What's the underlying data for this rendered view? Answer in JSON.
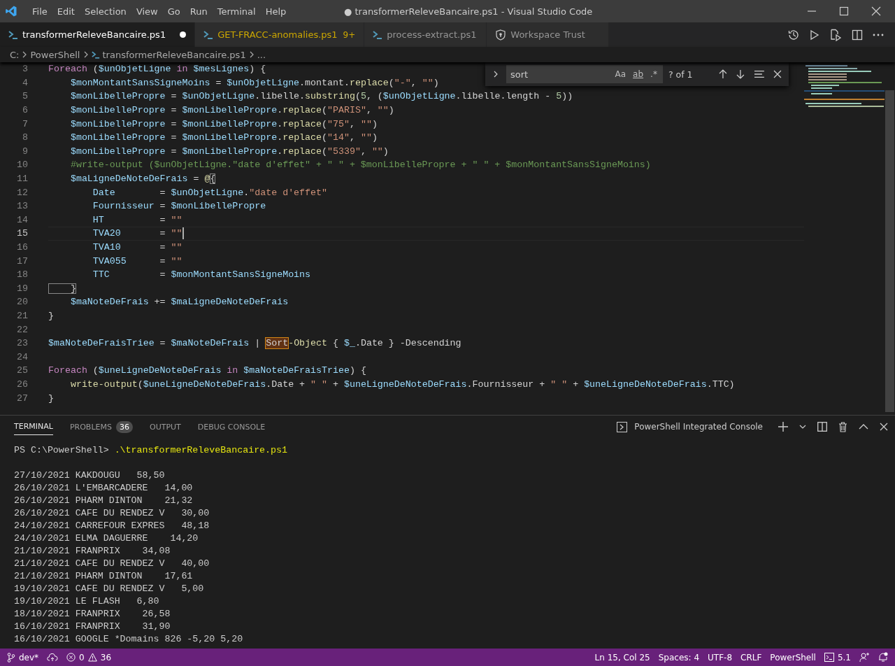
{
  "title_bar": {
    "menu": [
      "File",
      "Edit",
      "Selection",
      "View",
      "Go",
      "Run",
      "Terminal",
      "Help"
    ],
    "title": "● transformerReleveBancaire.ps1 - Visual Studio Code"
  },
  "tabs": [
    {
      "label": "transformerReleveBancaire.ps1",
      "selected": true,
      "kind": "file",
      "modified": true,
      "warning": false
    },
    {
      "label": "GET-FRACC-anomalies.ps1",
      "selected": false,
      "kind": "file",
      "modified": false,
      "warning": true,
      "badge": "9+"
    },
    {
      "label": "process-extract.ps1",
      "selected": false,
      "kind": "file",
      "modified": false,
      "warning": false
    },
    {
      "label": "Workspace Trust",
      "selected": false,
      "kind": "trust",
      "modified": false,
      "warning": false
    }
  ],
  "breadcrumb": [
    "C:",
    "PowerShell",
    "transformerReleveBancaire.ps1",
    "..."
  ],
  "find": {
    "value": "sort",
    "options": [
      {
        "label": "Aa",
        "on": false
      },
      {
        "label": "ab",
        "on": false
      },
      {
        "label": ".*",
        "on": false
      }
    ],
    "result": "? of 1"
  },
  "editor": {
    "lines": [
      {
        "number": "3",
        "current": false,
        "tokens": [
          {
            "kind": "k",
            "t": "Foreach"
          },
          {
            "kind": "p",
            "t": " ("
          },
          {
            "kind": "v",
            "t": "$unObjetLigne"
          },
          {
            "kind": "k",
            "t": " in "
          },
          {
            "kind": "v",
            "t": "$mesLignes"
          },
          {
            "kind": "p",
            "t": ") {"
          }
        ]
      },
      {
        "number": "4",
        "current": false,
        "tokens": [
          {
            "kind": "v",
            "t": "    $monMontantSansSigneMoins"
          },
          {
            "kind": "p",
            "t": " = "
          },
          {
            "kind": "v",
            "t": "$unObjetLigne"
          },
          {
            "kind": "p",
            "t": ".montant."
          },
          {
            "kind": "f",
            "t": "replace"
          },
          {
            "kind": "p",
            "t": "("
          },
          {
            "kind": "s",
            "t": "\"-\""
          },
          {
            "kind": "p",
            "t": ", "
          },
          {
            "kind": "s",
            "t": "\"\""
          },
          {
            "kind": "p",
            "t": ")"
          }
        ]
      },
      {
        "number": "5",
        "current": false,
        "tokens": [
          {
            "kind": "v",
            "t": "    $monLibellePropre"
          },
          {
            "kind": "p",
            "t": " = "
          },
          {
            "kind": "v",
            "t": "$unObjetLigne"
          },
          {
            "kind": "p",
            "t": ".libelle."
          },
          {
            "kind": "f",
            "t": "substring"
          },
          {
            "kind": "p",
            "t": "("
          },
          {
            "kind": "n",
            "t": "5"
          },
          {
            "kind": "p",
            "t": ", ("
          },
          {
            "kind": "v",
            "t": "$unObjetLigne"
          },
          {
            "kind": "p",
            "t": ".libelle.length - "
          },
          {
            "kind": "n",
            "t": "5"
          },
          {
            "kind": "p",
            "t": "))"
          }
        ]
      },
      {
        "number": "6",
        "current": false,
        "tokens": [
          {
            "kind": "v",
            "t": "    $monLibellePropre"
          },
          {
            "kind": "p",
            "t": " = "
          },
          {
            "kind": "v",
            "t": "$monLibellePropre"
          },
          {
            "kind": "p",
            "t": "."
          },
          {
            "kind": "f",
            "t": "replace"
          },
          {
            "kind": "p",
            "t": "("
          },
          {
            "kind": "s",
            "t": "\"PARIS\""
          },
          {
            "kind": "p",
            "t": ", "
          },
          {
            "kind": "s",
            "t": "\"\""
          },
          {
            "kind": "p",
            "t": ")"
          }
        ]
      },
      {
        "number": "7",
        "current": false,
        "tokens": [
          {
            "kind": "v",
            "t": "    $monLibellePropre"
          },
          {
            "kind": "p",
            "t": " = "
          },
          {
            "kind": "v",
            "t": "$monLibellePropre"
          },
          {
            "kind": "p",
            "t": "."
          },
          {
            "kind": "f",
            "t": "replace"
          },
          {
            "kind": "p",
            "t": "("
          },
          {
            "kind": "s",
            "t": "\"75\""
          },
          {
            "kind": "p",
            "t": ", "
          },
          {
            "kind": "s",
            "t": "\"\""
          },
          {
            "kind": "p",
            "t": ")"
          }
        ]
      },
      {
        "number": "8",
        "current": false,
        "tokens": [
          {
            "kind": "v",
            "t": "    $monLibellePropre"
          },
          {
            "kind": "p",
            "t": " = "
          },
          {
            "kind": "v",
            "t": "$monLibellePropre"
          },
          {
            "kind": "p",
            "t": "."
          },
          {
            "kind": "f",
            "t": "replace"
          },
          {
            "kind": "p",
            "t": "("
          },
          {
            "kind": "s",
            "t": "\"14\""
          },
          {
            "kind": "p",
            "t": ", "
          },
          {
            "kind": "s",
            "t": "\"\""
          },
          {
            "kind": "p",
            "t": ")"
          }
        ]
      },
      {
        "number": "9",
        "current": false,
        "tokens": [
          {
            "kind": "v",
            "t": "    $monLibellePropre"
          },
          {
            "kind": "p",
            "t": " = "
          },
          {
            "kind": "v",
            "t": "$monLibellePropre"
          },
          {
            "kind": "p",
            "t": "."
          },
          {
            "kind": "f",
            "t": "replace"
          },
          {
            "kind": "p",
            "t": "("
          },
          {
            "kind": "s",
            "t": "\"5339\""
          },
          {
            "kind": "p",
            "t": ", "
          },
          {
            "kind": "s",
            "t": "\"\""
          },
          {
            "kind": "p",
            "t": ")"
          }
        ]
      },
      {
        "number": "10",
        "current": false,
        "tokens": [
          {
            "kind": "c",
            "t": "    #write-output ($unObjetLigne.\"date d'effet\" + \" \" + $monLibellePropre + \" \" + $monMontantSansSigneMoins)"
          }
        ]
      },
      {
        "number": "11",
        "current": false,
        "tokens": [
          {
            "kind": "v",
            "t": "    $maLigneDeNoteDeFrais"
          },
          {
            "kind": "p",
            "t": " = "
          },
          {
            "kind": "f",
            "t": "@"
          },
          {
            "kind": "b",
            "t": "{"
          }
        ]
      },
      {
        "number": "12",
        "current": false,
        "tokens": [
          {
            "kind": "v",
            "t": "        Date"
          },
          {
            "kind": "p",
            "t": "        = "
          },
          {
            "kind": "v",
            "t": "$unObjetLigne"
          },
          {
            "kind": "p",
            "t": "."
          },
          {
            "kind": "s",
            "t": "\"date d'effet\""
          }
        ]
      },
      {
        "number": "13",
        "current": false,
        "tokens": [
          {
            "kind": "v",
            "t": "        Fournisseur"
          },
          {
            "kind": "p",
            "t": " = "
          },
          {
            "kind": "v",
            "t": "$monLibellePropre"
          }
        ]
      },
      {
        "number": "14",
        "current": false,
        "tokens": [
          {
            "kind": "v",
            "t": "        HT"
          },
          {
            "kind": "p",
            "t": "          = "
          },
          {
            "kind": "s",
            "t": "\"\""
          }
        ]
      },
      {
        "number": "15",
        "current": true,
        "tokens": [
          {
            "kind": "v",
            "t": "        TVA20"
          },
          {
            "kind": "p",
            "t": "       = "
          },
          {
            "kind": "s",
            "t": "\"\""
          }
        ]
      },
      {
        "number": "16",
        "current": false,
        "tokens": [
          {
            "kind": "v",
            "t": "        TVA10"
          },
          {
            "kind": "p",
            "t": "       = "
          },
          {
            "kind": "s",
            "t": "\"\""
          }
        ]
      },
      {
        "number": "17",
        "current": false,
        "tokens": [
          {
            "kind": "v",
            "t": "        TVA055"
          },
          {
            "kind": "p",
            "t": "      = "
          },
          {
            "kind": "s",
            "t": "\"\""
          }
        ]
      },
      {
        "number": "18",
        "current": false,
        "tokens": [
          {
            "kind": "v",
            "t": "        TTC"
          },
          {
            "kind": "p",
            "t": "         = "
          },
          {
            "kind": "v",
            "t": "$monMontantSansSigneMoins"
          }
        ]
      },
      {
        "number": "19",
        "current": false,
        "tokens": [
          {
            "kind": "b",
            "t": "    }"
          }
        ]
      },
      {
        "number": "20",
        "current": false,
        "tokens": [
          {
            "kind": "v",
            "t": "    $maNoteDeFrais"
          },
          {
            "kind": "p",
            "t": " += "
          },
          {
            "kind": "v",
            "t": "$maLigneDeNoteDeFrais"
          }
        ]
      },
      {
        "number": "21",
        "current": false,
        "tokens": [
          {
            "kind": "p",
            "t": "}"
          }
        ]
      },
      {
        "number": "22",
        "current": false
      },
      {
        "number": "23",
        "current": false,
        "tokens": [
          {
            "kind": "v",
            "t": "$maNoteDeFraisTriee"
          },
          {
            "kind": "p",
            "t": " = "
          },
          {
            "kind": "v",
            "t": "$maNoteDeFrais"
          },
          {
            "kind": "p",
            "t": " | "
          },
          {
            "kind": "m",
            "t": "Sort"
          },
          {
            "kind": "f",
            "t": "-Object"
          },
          {
            "kind": "p",
            "t": " { "
          },
          {
            "kind": "v",
            "t": "$_"
          },
          {
            "kind": "p",
            "t": ".Date } -Descending"
          }
        ]
      },
      {
        "number": "24",
        "current": false
      },
      {
        "number": "25",
        "current": false,
        "tokens": [
          {
            "kind": "k",
            "t": "Foreach"
          },
          {
            "kind": "p",
            "t": " ("
          },
          {
            "kind": "v",
            "t": "$uneLigneDeNoteDeFrais"
          },
          {
            "kind": "k",
            "t": " in "
          },
          {
            "kind": "v",
            "t": "$maNoteDeFraisTriee"
          },
          {
            "kind": "p",
            "t": ") {"
          }
        ]
      },
      {
        "number": "26",
        "current": false,
        "tokens": [
          {
            "kind": "f",
            "t": "    write-output"
          },
          {
            "kind": "p",
            "t": "("
          },
          {
            "kind": "v",
            "t": "$uneLigneDeNoteDeFrais"
          },
          {
            "kind": "p",
            "t": ".Date + "
          },
          {
            "kind": "s",
            "t": "\" \""
          },
          {
            "kind": "p",
            "t": " + "
          },
          {
            "kind": "v",
            "t": "$uneLigneDeNoteDeFrais"
          },
          {
            "kind": "p",
            "t": ".Fournisseur + "
          },
          {
            "kind": "s",
            "t": "\" \""
          },
          {
            "kind": "p",
            "t": " + "
          },
          {
            "kind": "v",
            "t": "$uneLigneDeNoteDeFrais"
          },
          {
            "kind": "p",
            "t": ".TTC)"
          }
        ]
      },
      {
        "number": "27",
        "current": false,
        "tokens": [
          {
            "kind": "p",
            "t": "}"
          }
        ]
      }
    ]
  },
  "panel": {
    "tabs": [
      {
        "label": "TERMINAL",
        "selected": true
      },
      {
        "label": "PROBLEMS",
        "selected": false,
        "badge": "36"
      },
      {
        "label": "OUTPUT",
        "selected": false
      },
      {
        "label": "DEBUG CONSOLE",
        "selected": false
      }
    ],
    "terminal_name": "PowerShell Integrated Console",
    "prompt": "PS C:\\PowerShell> ",
    "command": ".\\transformerReleveBancaire.ps1",
    "output": [
      "27/10/2021 KAKDOUGU   58,50",
      "26/10/2021 L'EMBARCADERE   14,00",
      "26/10/2021 PHARM DINTON    21,32",
      "26/10/2021 CAFE DU RENDEZ V   30,00",
      "24/10/2021 CARREFOUR EXPRES   48,18",
      "24/10/2021 ELMA DAGUERRE    14,20",
      "21/10/2021 FRANPRIX    34,08",
      "21/10/2021 CAFE DU RENDEZ V   40,00",
      "21/10/2021 PHARM DINTON    17,61",
      "19/10/2021 CAFE DU RENDEZ V   5,00",
      "19/10/2021 LE FLASH   6,80",
      "18/10/2021 FRANPRIX    26,58",
      "16/10/2021 FRANPRIX    31,90",
      "16/10/2021 GOOGLE *Domains 826 -5,20 5,20"
    ]
  },
  "status_bar": {
    "branch": "dev*",
    "errors": "0",
    "warnings": "36",
    "right": [
      "Ln 15, Col 25",
      "Spaces: 4",
      "UTF-8",
      "CRLF",
      "PowerShell"
    ],
    "version": "5.1"
  }
}
